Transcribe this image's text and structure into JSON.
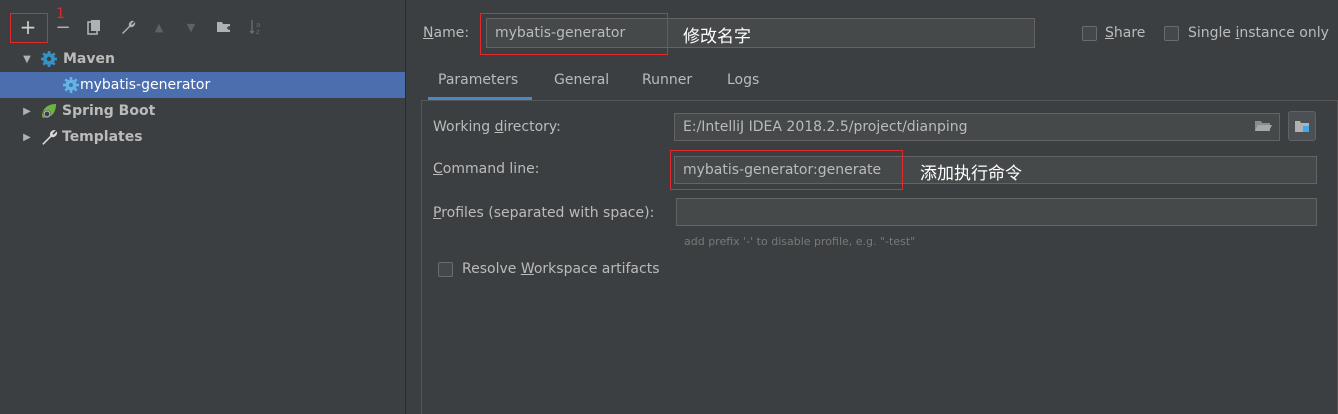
{
  "annotation_number": "1",
  "toolbar": {
    "add": "+",
    "remove": "−",
    "copy_icon": "copy-icon",
    "wrench_icon": "wrench-icon",
    "up": "▲",
    "down": "▼",
    "folder_icon": "folder-icon",
    "sort_icon": "sort-icon"
  },
  "tree": {
    "maven": "Maven",
    "maven_item": "mybatis-generator",
    "spring_boot": "Spring Boot",
    "templates": "Templates"
  },
  "header": {
    "name_label_pre": "N",
    "name_label_post": "ame:",
    "name_value": "mybatis-generator",
    "name_annotation": "修改名字",
    "share_pre": "S",
    "share_post": "hare",
    "single_pre": "Single ",
    "single_mn": "i",
    "single_post": "nstance only"
  },
  "tabs": [
    "Parameters",
    "General",
    "Runner",
    "Logs"
  ],
  "form": {
    "working_dir_label_pre": "Working ",
    "working_dir_label_mn": "d",
    "working_dir_label_post": "irectory:",
    "working_dir_value": "E:/IntelliJ IDEA 2018.2.5/project/dianping",
    "command_label_mn": "C",
    "command_label_post": "ommand line:",
    "command_value": "mybatis-generator:generate",
    "command_annotation": "添加执行命令",
    "profiles_label_mn": "P",
    "profiles_label_post": "rofiles (separated with space):",
    "profiles_value": "",
    "profiles_hint": "add prefix '-' to disable profile, e.g. \"-test\"",
    "resolve_pre": "Resolve ",
    "resolve_mn": "W",
    "resolve_post": "orkspace artifacts"
  },
  "colors": {
    "background": "#3c3f41",
    "selection": "#4b6eaf",
    "annotation_red": "#e0282d",
    "field": "#45494a"
  }
}
